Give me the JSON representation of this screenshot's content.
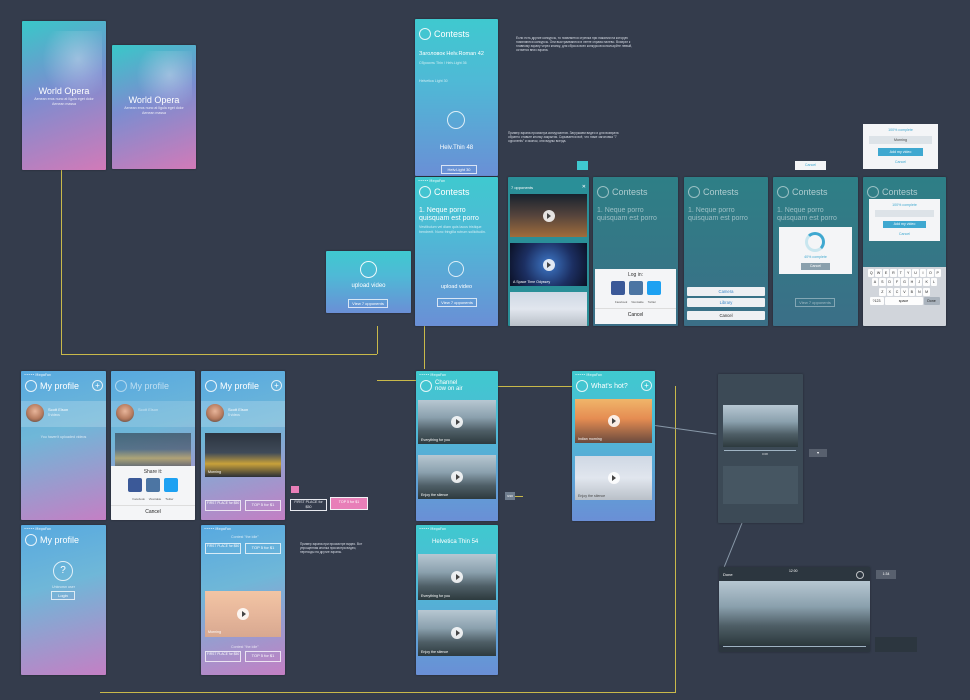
{
  "colors": {
    "background": "#343c4c",
    "connector": "#c9b94a",
    "accent_pink": "#e87fb8",
    "accent_teal": "#3fc9cf"
  },
  "splash": {
    "title": "World Opera",
    "subtitle_line1": "Aenean eros nunc at ligula eget dolor",
    "subtitle_line2": "Aenean massa"
  },
  "contests": {
    "title": "Contests",
    "heading": "Заголовок Helv.Roman 42",
    "sub1": "Сбросить Thin / Helv.Light 36",
    "sub2": "Helvetica Light 30",
    "upload_label": "Helv.Thin 48",
    "button": "Helv.Light 30",
    "item_title": "1. Neque porro quisquam est porro",
    "item_body": "Vestibulum vel diam quis lacus tristique hendrerit. Nunc fringilla rutrum sollicitudin.",
    "upload_video": "upload video",
    "view_opponents": "View 7 opponents",
    "opponents_header": "7 opponents",
    "video_captions": [
      "A Space Time Odyssey",
      ""
    ],
    "log_in_title": "Log in:",
    "social": [
      "Facebook",
      "Vkontakte",
      "Twitter"
    ],
    "cancel": "Cancel",
    "camera": "Camera",
    "library": "Library",
    "progress": "40% complete",
    "progress2": "100% complete",
    "morning": "Morning",
    "add_video": "Add my video",
    "cancel_small": "Cancel",
    "keyboard_row1": [
      "Q",
      "W",
      "E",
      "R",
      "T",
      "Y",
      "U",
      "I",
      "O",
      "P"
    ],
    "keyboard_row2": [
      "A",
      "S",
      "D",
      "F",
      "G",
      "H",
      "J",
      "K",
      "L"
    ],
    "keyboard_row3": [
      "Z",
      "X",
      "C",
      "V",
      "B",
      "N",
      "M"
    ],
    "keyboard_bottom": [
      "?123",
      "space",
      "Done"
    ]
  },
  "annotations": {
    "top_right": "Если есть другие конкурсы, то появляется стрелка при нажатии на которую появляются конкурсы. Они выстраиваются в ленте справа налево. Возврат к главному экрану через кнопку, для сброса всех конкурсов используйте левый, остается вниз экрана.",
    "middle": "Пример экрана просмотра конкурсантов. Загружаем видео и для возврата обратно ставьте кнопку закрытия. Скрывается всё, что ниже заголовка \"7 opponents\" и иконок, они видны всегда.",
    "profile": "Пример экрана при просмотре видео. Вот упрощенная кнопка просмотра видео, переходы на другие экраны."
  },
  "profile": {
    "title": "My profile",
    "name": "Scott Elson",
    "sub": "5 videos",
    "empty_text": "You haven't uploaded videos",
    "share_title": "Share it:",
    "unknown_user": "Unknown user",
    "login": "Login",
    "first_place": "FIRST PLACE for $50",
    "top5": "TOP 5 for $1",
    "contest_meta": "Contest \"the idle\"",
    "morning_caption": "Morning"
  },
  "channel": {
    "title_line1": "Channel",
    "title_line2": "now on air",
    "captions": [
      "Everything for you",
      "Enjoy the silence"
    ],
    "helvetica": "Helvetica Thin 54",
    "captions2": [
      "Everything for you",
      "Enjoy the silence"
    ],
    "badge": "9/20"
  },
  "hot": {
    "title": "What's hot?",
    "captions": [
      "Indian morning",
      "Enjoy the silence"
    ]
  },
  "player": {
    "done": "Done",
    "time": "12:00",
    "elapsed": "0:08",
    "badge": "1:34"
  },
  "statusbar": {
    "carrier": "••••• MegaFon",
    "time": "12:00"
  }
}
